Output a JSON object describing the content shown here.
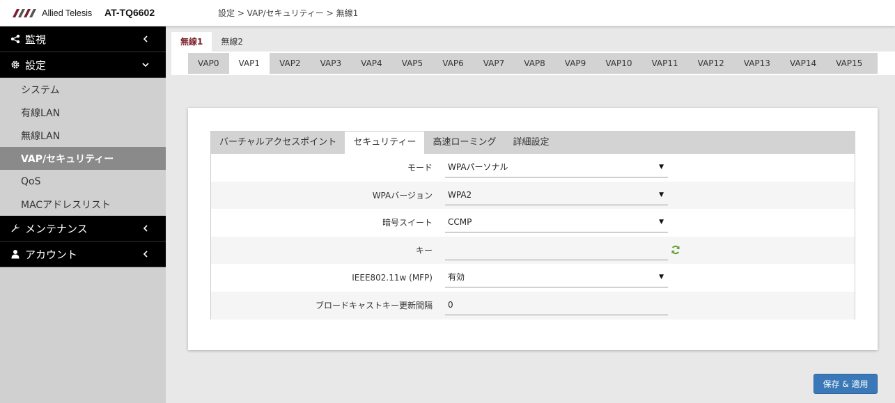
{
  "header": {
    "brand": "Allied Telesis",
    "model": "AT-TQ6602",
    "breadcrumb": "設定 > VAP/セキュリティー > 無線1"
  },
  "sidebar": {
    "sections": [
      {
        "label": "監視",
        "icon": "share-icon",
        "expanded": false
      },
      {
        "label": "設定",
        "icon": "gear-icon",
        "expanded": true
      },
      {
        "label": "メンテナンス",
        "icon": "wrench-icon",
        "expanded": false
      },
      {
        "label": "アカウント",
        "icon": "user-icon",
        "expanded": false
      }
    ],
    "settings_items": [
      {
        "label": "システム"
      },
      {
        "label": "有線LAN"
      },
      {
        "label": "無線LAN"
      },
      {
        "label": "VAP/セキュリティー",
        "active": true
      },
      {
        "label": "QoS"
      },
      {
        "label": "MACアドレスリスト"
      }
    ]
  },
  "radio_tabs": [
    "無線1",
    "無線2"
  ],
  "radio_active": "無線1",
  "vap_tabs": [
    "VAP0",
    "VAP1",
    "VAP2",
    "VAP3",
    "VAP4",
    "VAP5",
    "VAP6",
    "VAP7",
    "VAP8",
    "VAP9",
    "VAP10",
    "VAP11",
    "VAP12",
    "VAP13",
    "VAP14",
    "VAP15"
  ],
  "vap_active": "VAP1",
  "sub_tabs": [
    "バーチャルアクセスポイント",
    "セキュリティー",
    "高速ローミング",
    "詳細設定"
  ],
  "sub_active": "セキュリティー",
  "form": {
    "mode": {
      "label": "モード",
      "value": "WPAパーソナル"
    },
    "wpa_version": {
      "label": "WPAバージョン",
      "value": "WPA2"
    },
    "cipher": {
      "label": "暗号スイート",
      "value": "CCMP"
    },
    "key": {
      "label": "キー",
      "value": ""
    },
    "mfp": {
      "label": "IEEE802.11w (MFP)",
      "value": "有効"
    },
    "broadcast_interval": {
      "label": "ブロードキャストキー更新間隔",
      "value": "0"
    }
  },
  "buttons": {
    "save": "保存 & 適用"
  },
  "colors": {
    "accent": "#7a1f2b",
    "save_button": "#3a78b8",
    "refresh_icon": "#5aa02c"
  }
}
